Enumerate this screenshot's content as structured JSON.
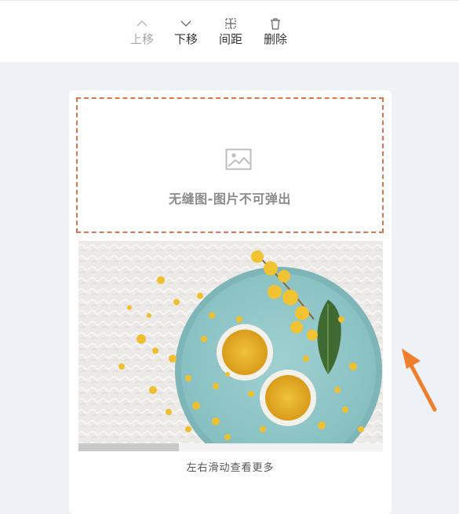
{
  "toolbar": {
    "items": [
      {
        "label": "上移",
        "icon": "chevron-up-icon",
        "disabled": true
      },
      {
        "label": "下移",
        "icon": "chevron-down-icon",
        "disabled": false
      },
      {
        "label": "间距",
        "icon": "spacing-grid-icon",
        "disabled": false
      },
      {
        "label": "删除",
        "icon": "trash-icon",
        "disabled": false
      }
    ]
  },
  "component": {
    "placeholder_icon": "image-icon",
    "placeholder_text": "无缝图-图片不可弹出",
    "photo_icon": "photo-osmanthus-plate",
    "scroll_progress": 0.33,
    "hint_text": "左右滑动查看更多"
  },
  "colors": {
    "accent": "#e2734a",
    "arrow": "#f07f2c",
    "background": "#eef1f6"
  }
}
